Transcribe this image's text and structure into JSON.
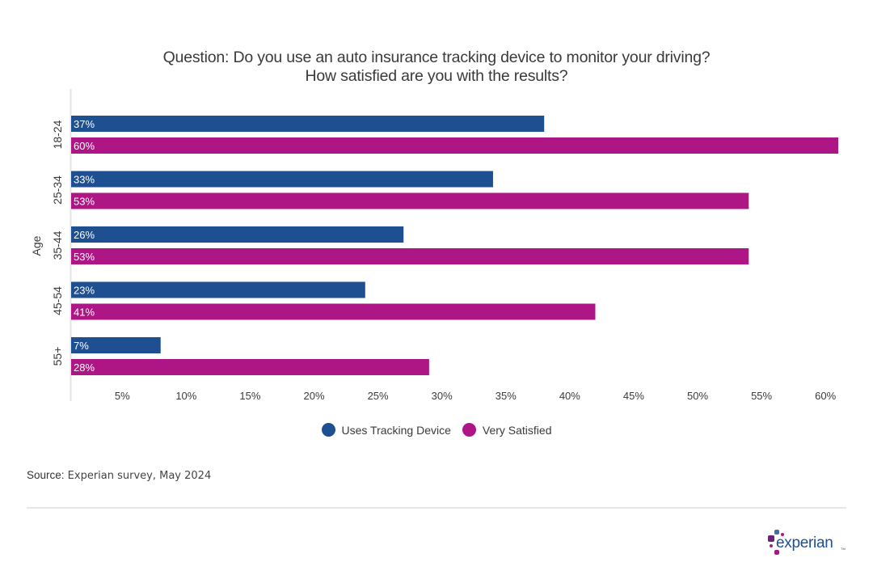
{
  "title_lines": [
    "Question: Do you use an auto insurance tracking device to monitor your driving?",
    "How satisfied are you with the results?"
  ],
  "colors": {
    "tracking": "#1d4f91",
    "satisfied": "#af1685",
    "axis": "#e4e4e4",
    "text": "#3a3a3a"
  },
  "chart_data": {
    "type": "bar",
    "orientation": "horizontal",
    "title": "Question: Do you use an auto insurance tracking device to monitor your driving? How satisfied are you with the results?",
    "xlabel": "",
    "ylabel": "Age",
    "categories": [
      "18-24",
      "25-34",
      "35-44",
      "45-54",
      "55+"
    ],
    "series": [
      {
        "name": "Uses Tracking Device",
        "values": [
          37,
          33,
          26,
          23,
          7
        ],
        "labels": [
          "37%",
          "33%",
          "26%",
          "23%",
          "7%"
        ]
      },
      {
        "name": "Very Satisfied",
        "values": [
          60,
          53,
          53,
          41,
          28
        ],
        "labels": [
          "60%",
          "53%",
          "53%",
          "41%",
          "28%"
        ]
      }
    ],
    "xticks": [
      "5%",
      "10%",
      "15%",
      "20%",
      "25%",
      "30%",
      "35%",
      "40%",
      "45%",
      "50%",
      "55%",
      "60%"
    ],
    "xlim": [
      0,
      60
    ],
    "grid": false,
    "legend_position": "bottom-center"
  },
  "legend": [
    {
      "label": "Uses Tracking Device"
    },
    {
      "label": "Very Satisfied"
    }
  ],
  "source": {
    "label": "Source:",
    "text": " Experian survey, May 2024"
  },
  "logo": {
    "text": "experian",
    "tm": "TM"
  }
}
